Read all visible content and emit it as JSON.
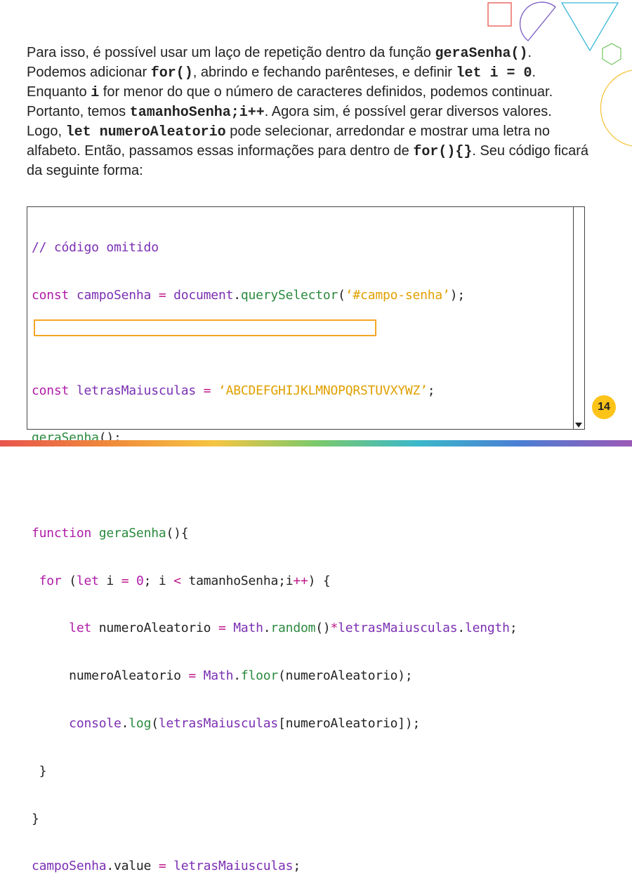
{
  "paragraph": {
    "t1": "Para isso, é possível usar um laço de repetição dentro da função ",
    "c1": "geraSenha()",
    "t2": ". Podemos adicionar ",
    "c2": "for()",
    "t3": ", abrindo e fechando parênteses, e definir ",
    "c3": "let i = 0",
    "t4": ". Enquanto ",
    "c4": "i",
    "t5": " for menor do que o número de caracteres definidos, podemos continuar. Portanto, temos ",
    "c5": "tamanhoSenha;i++",
    "t6": ". Agora sim, é possível gerar diversos valores. Logo, ",
    "c6": "let numeroAleatorio",
    "t7": " pode selecionar, arredondar e mostrar uma letra no alfabeto. Então, passamos essas informações para dentro de ",
    "c7": "for(){}",
    "t8": ". Seu código ficará da seguinte forma:"
  },
  "code": {
    "l1": "// código omitido",
    "l2a": "const",
    "l2b": " campoSenha ",
    "l2c": "=",
    "l2d": " document",
    "l2e": ".",
    "l2f": "querySelector",
    "l2g": "(",
    "l2h": "‘#campo-senha’",
    "l2i": ");",
    "l4a": "const",
    "l4b": " letrasMaiusculas ",
    "l4c": "=",
    "l4d": " ‘ABCDEFGHIJKLMNOPQRSTUVXYWZ’",
    "l4e": ";",
    "l5a": "geraSenha",
    "l5b": "();",
    "l7a": "function",
    "l7b": " geraSenha",
    "l7c": "(){",
    "l8a": " for",
    "l8b": " (",
    "l8c": "let",
    "l8d": " i ",
    "l8e": "=",
    "l8f": " 0",
    "l8g": "; i ",
    "l8h": "<",
    "l8i": " tamanhoSenha;i",
    "l8j": "++",
    "l8k": ") {",
    "l9a": "     let",
    "l9b": " numeroAleatorio ",
    "l9c": "=",
    "l9d": " Math",
    "l9e": ".",
    "l9f": "random",
    "l9g": "()",
    "l9h": "*",
    "l9i": "letrasMaiusculas",
    "l9j": ".",
    "l9k": "length",
    "l9l": ";",
    "l10a": "     numeroAleatorio ",
    "l10b": "=",
    "l10c": " Math",
    "l10d": ".",
    "l10e": "floor",
    "l10f": "(numeroAleatorio);",
    "l11a": "     console",
    "l11b": ".",
    "l11c": "log",
    "l11d": "(",
    "l11e": "letrasMaiusculas",
    "l11f": "[numeroAleatorio]);",
    "l12": " }",
    "l13": "}",
    "l14a": "campoSenha",
    "l14b": ".value ",
    "l14c": "=",
    "l14d": " letrasMaiusculas",
    "l14e": ";"
  },
  "page_number": "14",
  "colors": {
    "keyword": "#b01ca8",
    "function": "#2b8a3e",
    "variable": "#7b2fb3",
    "string": "#e0a000",
    "highlight_border": "#f5a623",
    "badge": "#fcc419"
  }
}
